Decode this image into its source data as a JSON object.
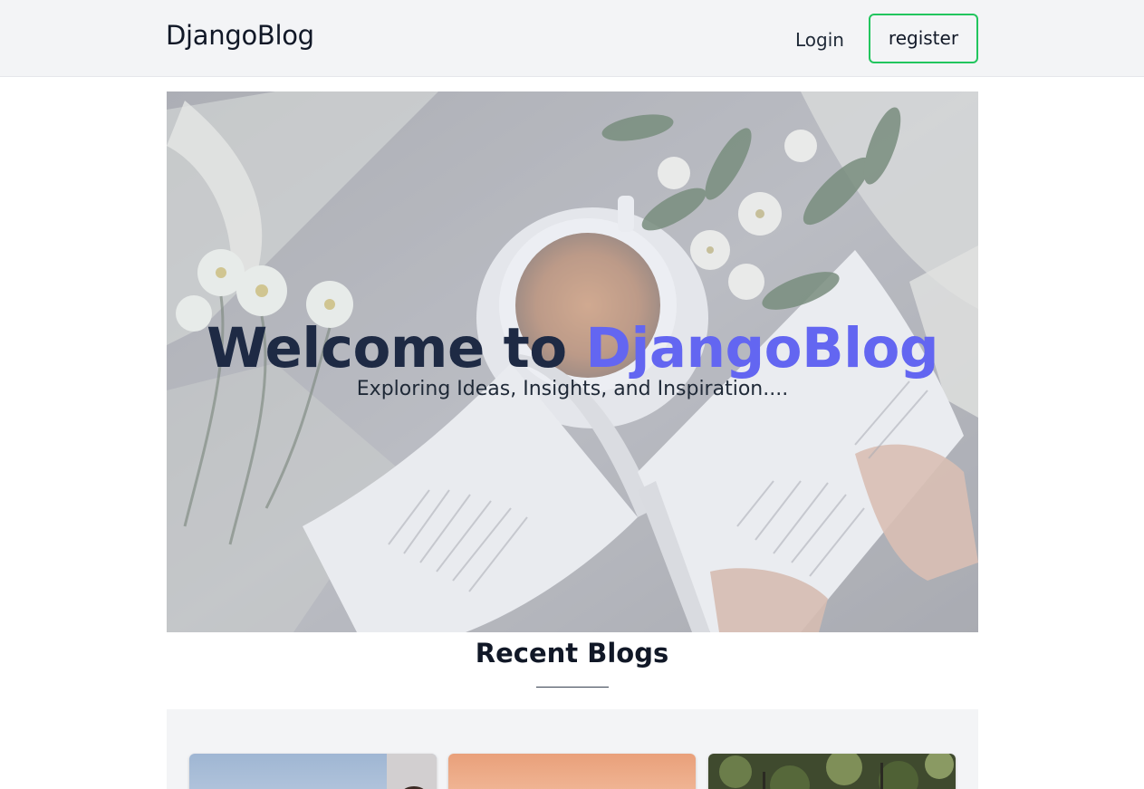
{
  "header": {
    "brand": "DjangoBlog",
    "login_label": "Login",
    "register_label": "register",
    "register_border_color": "#22c55e"
  },
  "hero": {
    "title_prefix": "Welcome to ",
    "title_accent": "DjangoBlog",
    "subtitle": "Exploring Ideas, Insights, and Inspiration....",
    "accent_color": "#6366f1"
  },
  "recent": {
    "heading": "Recent Blogs",
    "cards": [
      {
        "image_name": "blog-thumbnail-sky"
      },
      {
        "image_name": "blog-thumbnail-sunset"
      },
      {
        "image_name": "blog-thumbnail-forest"
      }
    ]
  }
}
